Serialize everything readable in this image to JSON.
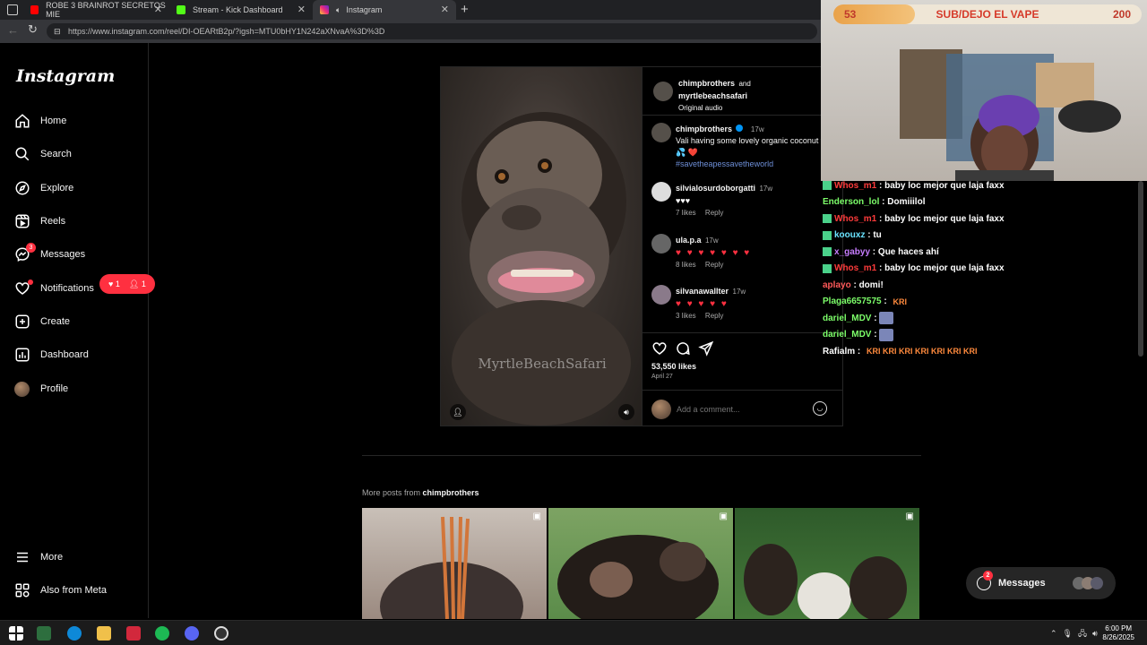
{
  "browser": {
    "tabs": [
      {
        "title": "ROBE 3 BRAINROT SECRETOS MIE",
        "color": "#ff0000"
      },
      {
        "title": "Stream - Kick Dashboard",
        "color": "#53fc18"
      },
      {
        "title": "Instagram",
        "color": "#e1306c"
      }
    ],
    "new_tab": "+",
    "url": "https://www.instagram.com/reel/DI-OEARtB2p/?igsh=MTU0bHY1N242aXNvaA%3D%3D"
  },
  "instagram": {
    "logo": "Instagram",
    "nav": [
      {
        "label": "Home",
        "icon": "home-icon"
      },
      {
        "label": "Search",
        "icon": "search-icon"
      },
      {
        "label": "Explore",
        "icon": "compass-icon"
      },
      {
        "label": "Reels",
        "icon": "reels-icon"
      },
      {
        "label": "Messages",
        "icon": "messenger-icon",
        "badge": "3"
      },
      {
        "label": "Notifications",
        "icon": "heart-icon"
      },
      {
        "label": "Create",
        "icon": "plus-square-icon"
      },
      {
        "label": "Dashboard",
        "icon": "dashboard-icon"
      },
      {
        "label": "Profile",
        "icon": "avatar"
      }
    ],
    "notif_pill": {
      "likes": "1",
      "follows": "1"
    },
    "bottom_nav": [
      {
        "label": "More",
        "icon": "menu-icon"
      },
      {
        "label": "Also from Meta",
        "icon": "meta-icon"
      }
    ],
    "post": {
      "watermark": "MyrtleBeachSafari",
      "author": "chimpbrothers",
      "and": "and",
      "collab": "myrtlebeachsafari",
      "audio": "Original audio",
      "caption_user": "chimpbrothers",
      "caption_time": "17w",
      "caption_text": "Vali having some lovely organic coconut water 🥥 💦 ❤️",
      "caption_tag": "#savetheapessavetheworld",
      "comments": [
        {
          "user": "silvialosurdoborgatti",
          "time": "17w",
          "text": "♥♥♥",
          "likes": "7 likes",
          "reply": "Reply"
        },
        {
          "user": "ula.p.a",
          "time": "17w",
          "text": "♥ ♥ ♥ ♥ ♥ ♥ ♥",
          "likes": "8 likes",
          "reply": "Reply"
        },
        {
          "user": "silvanawallter",
          "time": "17w",
          "text": "♥ ♥ ♥ ♥ ♥",
          "likes": "3 likes",
          "reply": "Reply"
        }
      ],
      "like_count": "53,550 likes",
      "date": "April 27",
      "comment_placeholder": "Add a comment..."
    },
    "more_posts_prefix": "More posts from",
    "more_posts_user": "chimpbrothers",
    "messages_button": "Messages",
    "messages_badge": "2"
  },
  "stream": {
    "goal_current": "53",
    "goal_label": "SUB/DEJO EL VAPE",
    "goal_target": "200",
    "goal_progress": 0.265,
    "chat": [
      {
        "user": "Whos_m1",
        "color": "#ff3b3b",
        "badge": true,
        "msg": "baby loc mejor que laja faxx"
      },
      {
        "user": "Enderson_lol",
        "color": "#7dff6a",
        "badge": false,
        "msg": "Domiiilol"
      },
      {
        "user": "Whos_m1",
        "color": "#ff3b3b",
        "badge": true,
        "msg": "baby loc mejor que laja faxx"
      },
      {
        "user": "koouxz",
        "color": "#6ae3ff",
        "badge": true,
        "msg": "tu"
      },
      {
        "user": "x_gabyy",
        "color": "#c77dff",
        "badge": true,
        "msg": "Que haces ahí"
      },
      {
        "user": "Whos_m1",
        "color": "#ff3b3b",
        "badge": true,
        "msg": "baby loc mejor que laja faxx"
      },
      {
        "user": "aplayo",
        "color": "#ff5a5a",
        "badge": false,
        "msg": "domi!"
      },
      {
        "user": "Plaga6657575",
        "color": "#7dff6a",
        "badge": false,
        "msg": "KRI"
      },
      {
        "user": "dariel_MDV",
        "color": "#7dff6a",
        "badge": false,
        "msg": ""
      },
      {
        "user": "dariel_MDV",
        "color": "#7dff6a",
        "badge": false,
        "msg": ""
      },
      {
        "user": "Rafialm",
        "color": "#ffffff",
        "badge": false,
        "msg": "KRI KRI KRI KRI KRI KRI KRI"
      }
    ]
  },
  "taskbar": {
    "time": "6:00 PM",
    "date": "8/26/2025"
  }
}
